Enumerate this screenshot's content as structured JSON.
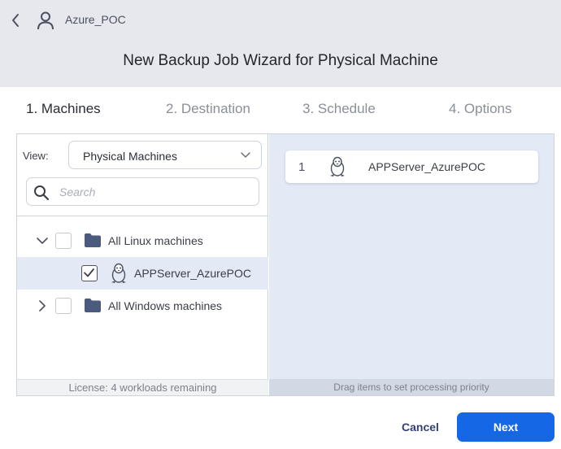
{
  "header": {
    "back_icon": "chevron-left-icon",
    "user_icon": "user-icon",
    "user_name": "Azure_POC",
    "title": "New Backup Job Wizard for Physical Machine"
  },
  "steps": [
    {
      "label": "1. Machines",
      "active": true
    },
    {
      "label": "2. Destination",
      "active": false
    },
    {
      "label": "3. Schedule",
      "active": false
    },
    {
      "label": "4. Options",
      "active": false
    }
  ],
  "left": {
    "view_label": "View:",
    "view_selected": "Physical Machines",
    "search_placeholder": "Search",
    "search_value": "",
    "tree": [
      {
        "label": "All Linux machines",
        "expanded": true,
        "checked": false,
        "icon": "folder-icon"
      },
      {
        "label": "APPServer_AzurePOC",
        "checked": true,
        "selected": true,
        "icon": "linux-icon"
      },
      {
        "label": "All Windows machines",
        "expanded": false,
        "checked": false,
        "icon": "folder-icon"
      }
    ],
    "footer": "License: 4 workloads remaining"
  },
  "right": {
    "queue": [
      {
        "index": "1",
        "label": "APPServer_AzurePOC",
        "icon": "linux-icon"
      }
    ],
    "footer": "Drag items to set processing priority"
  },
  "buttons": {
    "cancel": "Cancel",
    "next": "Next"
  },
  "colors": {
    "accent": "#1667e6",
    "header_bg": "#e6e8ee",
    "selection_bg": "#e3e9f5",
    "folder": "#4a5b7e"
  }
}
